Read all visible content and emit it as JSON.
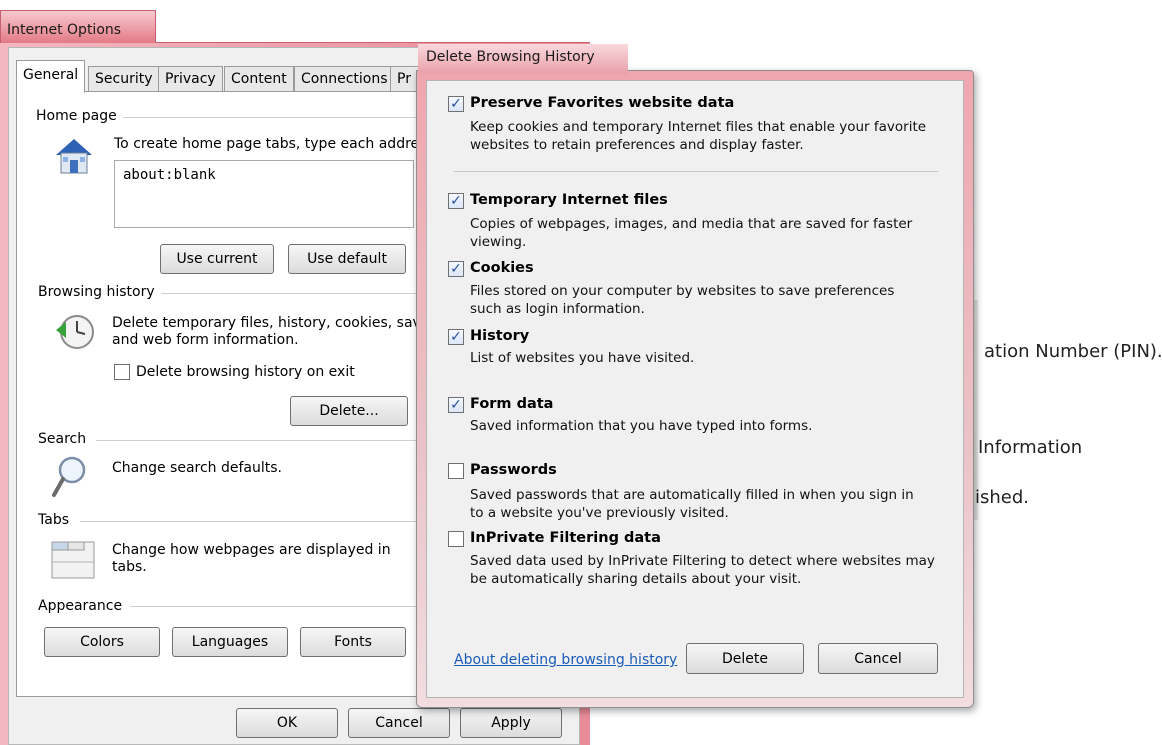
{
  "background_page": {
    "line1": "ation Number (PIN).",
    "line2": "Information",
    "line3": "ished."
  },
  "internet_options": {
    "title": "Internet Options",
    "tabs": [
      {
        "label": "General",
        "active": true
      },
      {
        "label": "Security"
      },
      {
        "label": "Privacy"
      },
      {
        "label": "Content"
      },
      {
        "label": "Connections"
      },
      {
        "label": "Pr"
      }
    ],
    "home_page": {
      "label": "Home page",
      "instructions": "To create home page tabs, type each addres",
      "value": "about:blank",
      "use_current": "Use current",
      "use_default": "Use default"
    },
    "browsing_history": {
      "label": "Browsing history",
      "text_line1": "Delete temporary files, history, cookies, save",
      "text_line2": "and web form information.",
      "delete_on_exit": "Delete browsing history on exit",
      "delete_on_exit_checked": false,
      "delete_button": "Delete..."
    },
    "search": {
      "label": "Search",
      "text": "Change search defaults."
    },
    "tabs_group": {
      "label": "Tabs",
      "text_line1": "Change how webpages are displayed in",
      "text_line2": "tabs."
    },
    "appearance": {
      "label": "Appearance",
      "colors": "Colors",
      "languages": "Languages",
      "fonts": "Fonts"
    },
    "footer": {
      "ok": "OK",
      "cancel": "Cancel",
      "apply": "Apply"
    }
  },
  "delete_dialog": {
    "title": "Delete Browsing History",
    "items": [
      {
        "title": "Preserve Favorites website data",
        "checked": true,
        "desc1": "Keep cookies and temporary Internet files that enable your favorite",
        "desc2": "websites to retain preferences and display faster."
      },
      {
        "title": "Temporary Internet files",
        "checked": true,
        "desc1": "Copies of webpages, images, and media that are saved for faster",
        "desc2": "viewing."
      },
      {
        "title": "Cookies",
        "checked": true,
        "desc1": "Files stored on your computer by websites to save preferences",
        "desc2": "such as login information."
      },
      {
        "title": "History",
        "checked": true,
        "desc1": "List of websites you have visited.",
        "desc2": ""
      },
      {
        "title": "Form data",
        "checked": true,
        "desc1": "Saved information that you have typed into forms.",
        "desc2": ""
      },
      {
        "title": "Passwords",
        "checked": false,
        "desc1": "Saved passwords that are automatically filled in when you sign in",
        "desc2": "to a website you've previously visited."
      },
      {
        "title": "InPrivate Filtering data",
        "checked": false,
        "desc1": "Saved data used by InPrivate Filtering to detect where websites may",
        "desc2": "be automatically sharing details about your visit."
      }
    ],
    "about_link": "About deleting browsing history",
    "delete_button": "Delete",
    "cancel_button": "Cancel"
  }
}
